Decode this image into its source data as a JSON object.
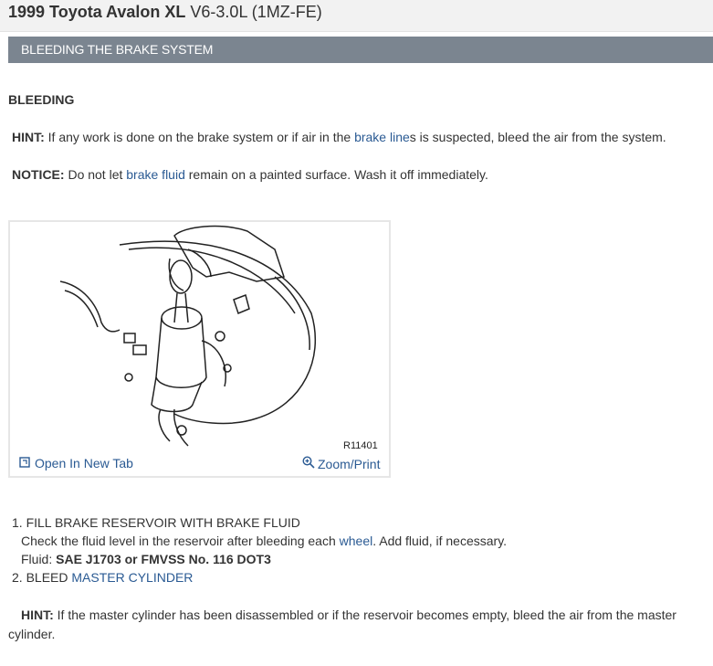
{
  "header": {
    "title_bold": "1999 Toyota Avalon XL",
    "title_rest": "V6-3.0L (1MZ-FE)"
  },
  "section": {
    "title": "BLEEDING THE BRAKE SYSTEM"
  },
  "content": {
    "heading": "BLEEDING",
    "hint": {
      "label": "HINT:",
      "pre": " If any work is done on the brake system or if air in the ",
      "link": "brake line",
      "post": "s is suspected, bleed the air from the system."
    },
    "notice": {
      "label": "NOTICE:",
      "pre": " Do not let ",
      "link": "brake fluid",
      "post": " remain on a painted surface. Wash it off immediately."
    }
  },
  "figure": {
    "code": "R11401",
    "open_label": "Open In New Tab",
    "zoom_label": "Zoom/Print",
    "open_icon": "open-in-new-tab-icon",
    "zoom_icon": "magnifier-plus-icon"
  },
  "steps": {
    "step1_title": "1. FILL BRAKE RESERVOIR WITH BRAKE FLUID",
    "step1_pre": "Check the fluid level in the reservoir after bleeding each ",
    "step1_link": "wheel",
    "step1_post": ". Add fluid, if necessary.",
    "fluid_label": "Fluid: ",
    "fluid_value": "SAE J1703 or FMVSS No. 116 DOT3",
    "step2_prefix": "2. BLEED ",
    "step2_link": "MASTER CYLINDER"
  },
  "hint2": {
    "label": "HINT:",
    "text": " If the master cylinder has been disassembled or if the reservoir becomes empty, bleed the air from the master cylinder."
  },
  "colors": {
    "header_bg": "#7b8590",
    "link": "#2a5a93"
  }
}
